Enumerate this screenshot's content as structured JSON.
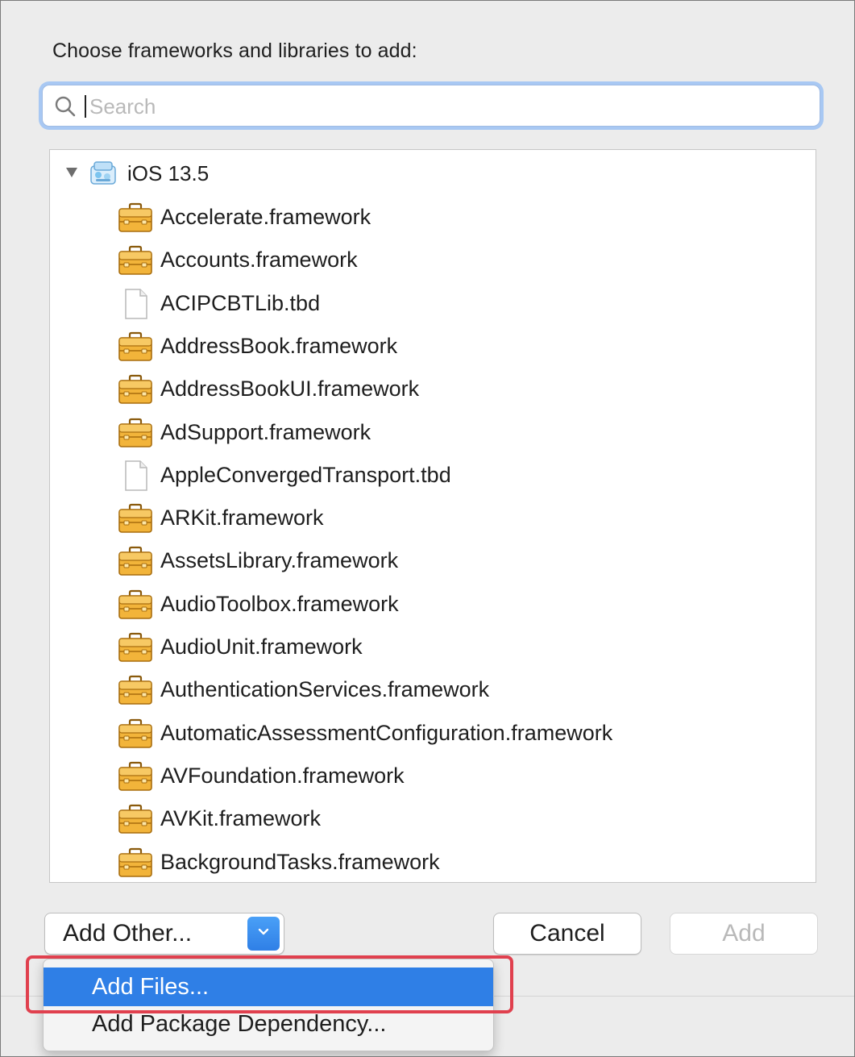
{
  "dialog": {
    "heading": "Choose frameworks and libraries to add:"
  },
  "search": {
    "placeholder": "Search",
    "value": ""
  },
  "list": {
    "root": {
      "label": "iOS 13.5",
      "icon": "sdk-icon",
      "expanded": true
    },
    "items": [
      {
        "label": "Accelerate.framework",
        "icon": "framework-icon"
      },
      {
        "label": "Accounts.framework",
        "icon": "framework-icon"
      },
      {
        "label": "ACIPCBTLib.tbd",
        "icon": "file-icon"
      },
      {
        "label": "AddressBook.framework",
        "icon": "framework-icon"
      },
      {
        "label": "AddressBookUI.framework",
        "icon": "framework-icon"
      },
      {
        "label": "AdSupport.framework",
        "icon": "framework-icon"
      },
      {
        "label": "AppleConvergedTransport.tbd",
        "icon": "file-icon"
      },
      {
        "label": "ARKit.framework",
        "icon": "framework-icon"
      },
      {
        "label": "AssetsLibrary.framework",
        "icon": "framework-icon"
      },
      {
        "label": "AudioToolbox.framework",
        "icon": "framework-icon"
      },
      {
        "label": "AudioUnit.framework",
        "icon": "framework-icon"
      },
      {
        "label": "AuthenticationServices.framework",
        "icon": "framework-icon"
      },
      {
        "label": "AutomaticAssessmentConfiguration.framework",
        "icon": "framework-icon"
      },
      {
        "label": "AVFoundation.framework",
        "icon": "framework-icon"
      },
      {
        "label": "AVKit.framework",
        "icon": "framework-icon"
      },
      {
        "label": "BackgroundTasks.framework",
        "icon": "framework-icon"
      }
    ]
  },
  "buttons": {
    "add_other": "Add Other...",
    "cancel": "Cancel",
    "add": "Add"
  },
  "menu": {
    "items": [
      {
        "label": "Add Files...",
        "selected": true
      },
      {
        "label": "Add Package Dependency...",
        "selected": false
      }
    ]
  },
  "colors": {
    "accent": "#2f7fe6",
    "focus_ring": "#a8c8f3",
    "highlight_box": "#e0404e",
    "framework_icon": "#f2b43a"
  }
}
